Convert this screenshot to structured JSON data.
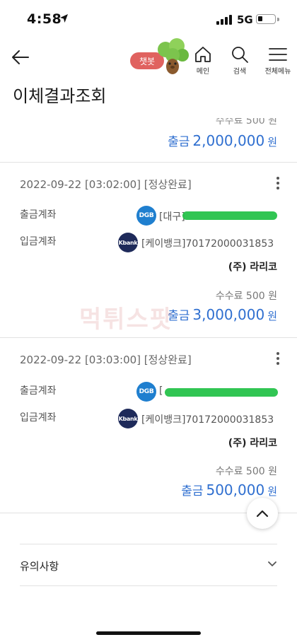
{
  "status_bar": {
    "time": "4:58",
    "network": "5G"
  },
  "header": {
    "chatbot_label": "챗봇",
    "home_label": "메인",
    "search_label": "검색",
    "menu_label": "전체메뉴"
  },
  "page_title": "이체결과조회",
  "partial_transaction": {
    "fee_text": "수수료 500 원",
    "amount_label": "출금",
    "amount": "2,000,000",
    "currency": "원"
  },
  "transactions": [
    {
      "datetime_status": "2022-09-22 [03:02:00] [정상완료]",
      "from_label": "출금계좌",
      "from_bank_logo": "DGB",
      "from_account": "[대구]",
      "to_label": "입금계좌",
      "to_bank_logo": "Kbank",
      "to_account": "[케이뱅크]70172000031853",
      "payee": "(주) 라리코",
      "fee_text": "수수료 500 원",
      "amount_label": "출금",
      "amount": "3,000,000",
      "currency": "원"
    },
    {
      "datetime_status": "2022-09-22 [03:03:00] [정상완료]",
      "from_label": "출금계좌",
      "from_bank_logo": "DGB",
      "from_account": "[",
      "to_label": "입금계좌",
      "to_bank_logo": "Kbank",
      "to_account": "[케이뱅크]70172000031853",
      "payee": "(주) 라리코",
      "fee_text": "수수료 500 원",
      "amount_label": "출금",
      "amount": "500,000",
      "currency": "원"
    }
  ],
  "watermark_text": "먹튀스팟",
  "notice": {
    "label": "유의사항"
  },
  "colors": {
    "amount_blue": "#2f6fd0",
    "chatbot_red": "#e0625f",
    "dgb_blue": "#1f7fcf",
    "kbank_navy": "#1e2a5a",
    "redaction_green": "#26c24a"
  }
}
